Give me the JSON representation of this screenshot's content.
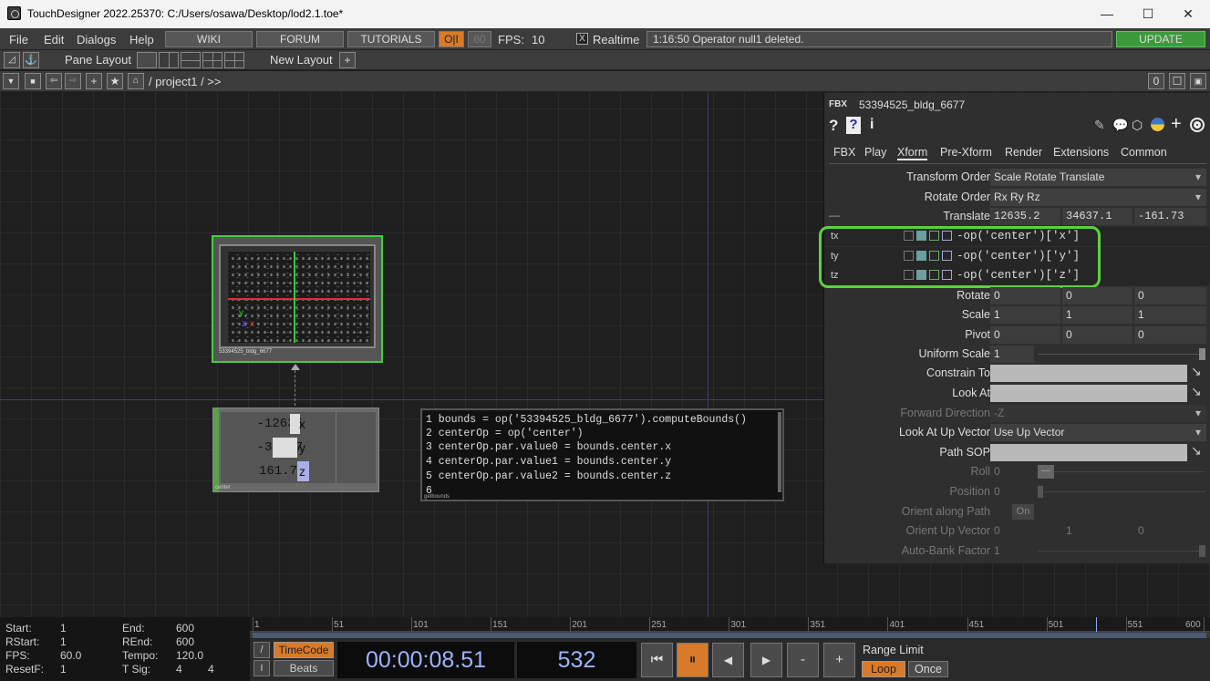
{
  "window": {
    "title": "TouchDesigner 2022.25370: C:/Users/osawa/Desktop/lod2.1.toe*",
    "minimize": "—",
    "maximize": "☐",
    "close": "✕"
  },
  "menu": {
    "items": [
      "File",
      "Edit",
      "Dialogs",
      "Help"
    ],
    "wiki": "WIKI",
    "forum": "FORUM",
    "tutorials": "TUTORIALS",
    "oi": "O|I",
    "sixty": "60",
    "fps_label": "FPS:",
    "fps_value": "10",
    "realtime_check": "X",
    "realtime": "Realtime",
    "status": "1:16:50 Operator null1 deleted.",
    "update": "UPDATE"
  },
  "toolbar2": {
    "pane_layout": "Pane Layout",
    "new_layout": "New Layout",
    "plus": "+"
  },
  "toolbar3": {
    "path": "/ project1 / >>",
    "count": "0"
  },
  "nodes": {
    "geo_label": "53394525_bldg_6677",
    "null_values": [
      {
        "num": "-12635",
        "axis": "x"
      },
      {
        "num": "-34637",
        "axis": "y"
      },
      {
        "num": "161.7",
        "axis": "z"
      }
    ],
    "null_label": "center",
    "script_lines": [
      "1 bounds = op('53394525_bldg_6677').computeBounds()",
      "2 centerOp = op('center')",
      "3 centerOp.par.value0 = bounds.center.x",
      "4 centerOp.par.value1 = bounds.center.y",
      "5 centerOp.par.value2 = bounds.center.z",
      "6"
    ],
    "script_label": "getbounds",
    "viewer_axes": {
      "y": "y",
      "x": "x",
      "z": "z"
    }
  },
  "param": {
    "type": "FBX",
    "name": "53394525_bldg_6677",
    "help1": "?",
    "help2": "?",
    "info": "i",
    "tabs": [
      "FBX",
      "Play",
      "Xform",
      "Pre-Xform",
      "Render",
      "Extensions",
      "Common"
    ],
    "transform_order_label": "Transform Order",
    "transform_order": "Scale Rotate Translate",
    "rotate_order_label": "Rotate Order",
    "rotate_order": "Rx Ry Rz",
    "translate_label": "Translate",
    "translate": [
      "12635.2",
      "34637.1",
      "-161.73"
    ],
    "minus": "—",
    "expr": [
      {
        "name": "tx",
        "value": "-op('center')['x']"
      },
      {
        "name": "ty",
        "value": "-op('center')['y']"
      },
      {
        "name": "tz",
        "value": "-op('center')['z']"
      }
    ],
    "rotate_label": "Rotate",
    "rotate": [
      "0",
      "0",
      "0"
    ],
    "scale_label": "Scale",
    "scale": [
      "1",
      "1",
      "1"
    ],
    "pivot_label": "Pivot",
    "pivot": [
      "0",
      "0",
      "0"
    ],
    "uniform_scale_label": "Uniform Scale",
    "uniform_scale": "1",
    "constrain_to_label": "Constrain To",
    "look_at_label": "Look At",
    "forward_direction_label": "Forward Direction",
    "forward_direction": "-Z",
    "look_at_up_label": "Look At Up Vector",
    "look_at_up": "Use Up Vector",
    "path_sop_label": "Path SOP",
    "roll_label": "Roll",
    "roll": "0",
    "position_label": "Position",
    "position": "0",
    "orient_path_label": "Orient along Path",
    "orient_path": "On",
    "orient_up_label": "Orient Up Vector",
    "orient_up": [
      "0",
      "1",
      "0"
    ],
    "auto_bank_label": "Auto-Bank Factor",
    "auto_bank": "1"
  },
  "timeline": {
    "start_label": "Start:",
    "start": "1",
    "end_label": "End:",
    "end": "600",
    "rstart_label": "RStart:",
    "rstart": "1",
    "rend_label": "REnd:",
    "rend": "600",
    "fps_label": "FPS:",
    "fps": "60.0",
    "tempo_label": "Tempo:",
    "tempo": "120.0",
    "resetf_label": "ResetF:",
    "resetf": "1",
    "tsig_label": "T Sig:",
    "tsig1": "4",
    "tsig2": "4",
    "ticks": [
      "1",
      "51",
      "101",
      "151",
      "201",
      "251",
      "301",
      "351",
      "401",
      "451",
      "501",
      "551",
      "600"
    ],
    "timecode": "TimeCode",
    "beats": "Beats",
    "time": "00:00:08.51",
    "frame": "532",
    "slash": "/",
    "bar": "I",
    "range_limit": "Range Limit",
    "loop": "Loop",
    "once": "Once",
    "ctl_start": "⏮",
    "ctl_pause": "⏸",
    "ctl_back": "◀",
    "ctl_fwd": "▶",
    "ctl_minus": "-",
    "ctl_plus": "+",
    "current_frame": 532
  },
  "colors": {
    "accent_orange": "#d87a2a",
    "update_green": "#3c9a3c",
    "highlight_green": "#5ad33a",
    "time_blue": "#9db4ff"
  }
}
